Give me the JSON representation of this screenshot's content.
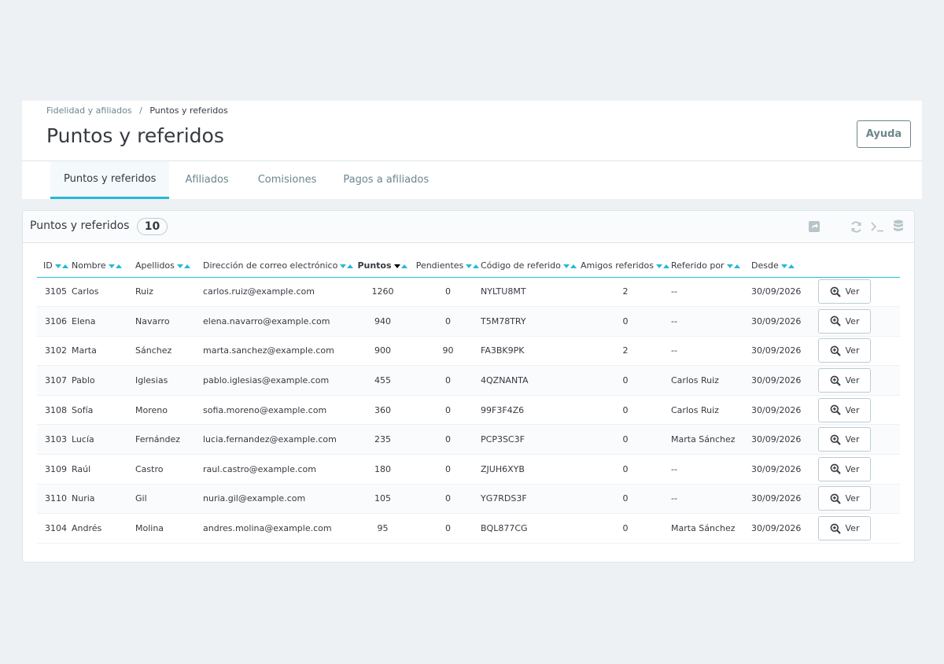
{
  "breadcrumb": {
    "parent": "Fidelidad y afiliados",
    "separator": "/",
    "current": "Puntos y referidos"
  },
  "page_title": "Puntos y referidos",
  "help_button": "Ayuda",
  "tabs": [
    {
      "label": "Puntos y referidos",
      "active": true
    },
    {
      "label": "Afiliados",
      "active": false
    },
    {
      "label": "Comisiones",
      "active": false
    },
    {
      "label": "Pagos a afiliados",
      "active": false
    }
  ],
  "panel": {
    "title": "Puntos y referidos",
    "count": "10",
    "tools": [
      "export-icon",
      "refresh-icon",
      "terminal-icon",
      "database-icon"
    ]
  },
  "columns": {
    "id": "ID",
    "nombre": "Nombre",
    "apellidos": "Apellidos",
    "email": "Dirección de correo electrónico",
    "puntos": "Puntos",
    "pendientes": "Pendientes",
    "codigo": "Código de referido",
    "amigos": "Amigos referidos",
    "referido_por": "Referido por",
    "desde": "Desde"
  },
  "sorted_column": "puntos",
  "view_button": "Ver",
  "rows": [
    {
      "id": "3105",
      "nombre": "Carlos",
      "apellidos": "Ruiz",
      "email": "carlos.ruiz@example.com",
      "puntos": "1260",
      "pendientes": "0",
      "codigo": "NYLTU8MT",
      "amigos": "2",
      "referido_por": "--",
      "desde": "30/09/2026"
    },
    {
      "id": "3106",
      "nombre": "Elena",
      "apellidos": "Navarro",
      "email": "elena.navarro@example.com",
      "puntos": "940",
      "pendientes": "0",
      "codigo": "T5M78TRY",
      "amigos": "0",
      "referido_por": "--",
      "desde": "30/09/2026"
    },
    {
      "id": "3102",
      "nombre": "Marta",
      "apellidos": "Sánchez",
      "email": "marta.sanchez@example.com",
      "puntos": "900",
      "pendientes": "90",
      "codigo": "FA3BK9PK",
      "amigos": "2",
      "referido_por": "--",
      "desde": "30/09/2026"
    },
    {
      "id": "3107",
      "nombre": "Pablo",
      "apellidos": "Iglesias",
      "email": "pablo.iglesias@example.com",
      "puntos": "455",
      "pendientes": "0",
      "codigo": "4QZNANTA",
      "amigos": "0",
      "referido_por": "Carlos Ruiz",
      "desde": "30/09/2026"
    },
    {
      "id": "3108",
      "nombre": "Sofía",
      "apellidos": "Moreno",
      "email": "sofia.moreno@example.com",
      "puntos": "360",
      "pendientes": "0",
      "codigo": "99F3F4Z6",
      "amigos": "0",
      "referido_por": "Carlos Ruiz",
      "desde": "30/09/2026"
    },
    {
      "id": "3103",
      "nombre": "Lucía",
      "apellidos": "Fernández",
      "email": "lucia.fernandez@example.com",
      "puntos": "235",
      "pendientes": "0",
      "codigo": "PCP3SC3F",
      "amigos": "0",
      "referido_por": "Marta Sánchez",
      "desde": "30/09/2026"
    },
    {
      "id": "3109",
      "nombre": "Raúl",
      "apellidos": "Castro",
      "email": "raul.castro@example.com",
      "puntos": "180",
      "pendientes": "0",
      "codigo": "ZJUH6XYB",
      "amigos": "0",
      "referido_por": "--",
      "desde": "30/09/2026"
    },
    {
      "id": "3110",
      "nombre": "Nuria",
      "apellidos": "Gil",
      "email": "nuria.gil@example.com",
      "puntos": "105",
      "pendientes": "0",
      "codigo": "YG7RDS3F",
      "amigos": "0",
      "referido_por": "--",
      "desde": "30/09/2026"
    },
    {
      "id": "3104",
      "nombre": "Andrés",
      "apellidos": "Molina",
      "email": "andres.molina@example.com",
      "puntos": "95",
      "pendientes": "0",
      "codigo": "BQL877CG",
      "amigos": "0",
      "referido_por": "Marta Sánchez",
      "desde": "30/09/2026"
    }
  ],
  "colors": {
    "accent": "#25b9d7",
    "text": "#363a41",
    "muted": "#6c868e",
    "background": "#eef1f4"
  }
}
